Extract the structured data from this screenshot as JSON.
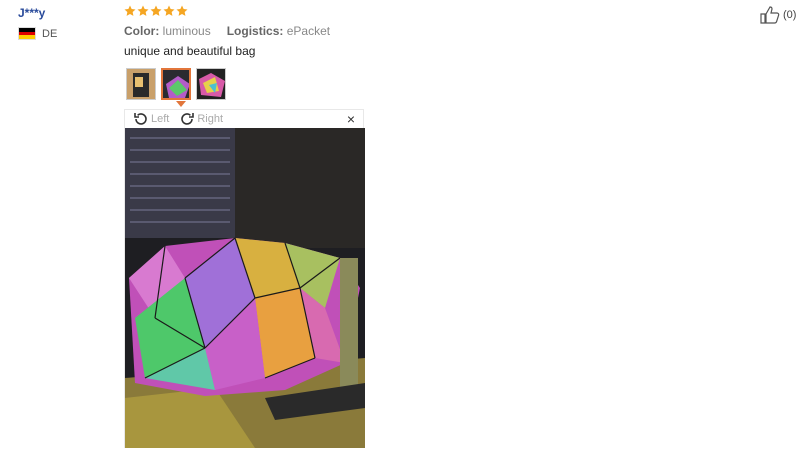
{
  "reviewer": {
    "name": "J***y",
    "country": "DE",
    "rating": 5
  },
  "review": {
    "color_label": "Color:",
    "color_value": "luminous",
    "logistics_label": "Logistics:",
    "logistics_value": "ePacket",
    "text": "unique and beautiful bag"
  },
  "viewer": {
    "rotate_left": "Left",
    "rotate_right": "Right",
    "close": "×"
  },
  "helpful": {
    "count": "(0)"
  },
  "colors": {
    "star": "#f5a623",
    "accent": "#e2763b",
    "username": "#2a4b9b"
  }
}
